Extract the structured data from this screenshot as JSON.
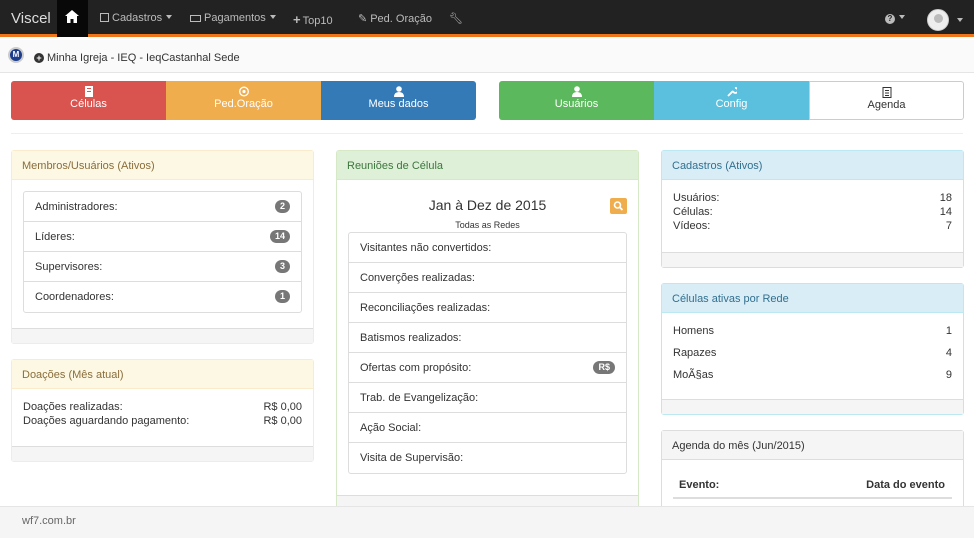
{
  "navbar": {
    "brand": "Viscel",
    "items": [
      "Cadastros",
      "Pagamentos",
      "Top10",
      "Ped. Oração"
    ]
  },
  "subbar": {
    "logo_text": "M",
    "church": "Minha Igreja - IEQ - IeqCastanhal Sede"
  },
  "tiles": [
    {
      "label": "Células",
      "color": "#d9534f"
    },
    {
      "label": "Ped.Oração",
      "color": "#f0ad4e"
    },
    {
      "label": "Meus dados",
      "color": "#337ab7"
    },
    {
      "label": "Usuários",
      "color": "#5cb85c"
    },
    {
      "label": "Config",
      "color": "#5bc0de"
    },
    {
      "label": "Agenda",
      "color": "#ffffff"
    }
  ],
  "membros": {
    "title": "Membros/Usuários (Ativos)",
    "items": [
      {
        "label": "Administradores:",
        "count": "2"
      },
      {
        "label": "Líderes:",
        "count": "14"
      },
      {
        "label": "Supervisores:",
        "count": "3"
      },
      {
        "label": "Coordenadores:",
        "count": "1"
      }
    ]
  },
  "doacoes": {
    "title": "Doações (Mês atual)",
    "rows": [
      {
        "label": "Doações realizadas:",
        "value": "R$ 0,00"
      },
      {
        "label": "Doações aguardando pagamento:",
        "value": "R$ 0,00"
      }
    ]
  },
  "reunioes": {
    "title": "Reuniões de Célula",
    "period": "Jan à Dez de 2015",
    "network": "Todas as Redes",
    "items": [
      {
        "label": "Visitantes não convertidos:",
        "badge": ""
      },
      {
        "label": "Converções realizadas:",
        "badge": ""
      },
      {
        "label": "Reconciliações realizadas:",
        "badge": ""
      },
      {
        "label": "Batismos realizados:",
        "badge": ""
      },
      {
        "label": "Ofertas com propósito:",
        "badge": "R$"
      },
      {
        "label": "Trab. de Evangelização:",
        "badge": ""
      },
      {
        "label": "Ação Social:",
        "badge": ""
      },
      {
        "label": "Visita de Supervisão:",
        "badge": ""
      }
    ]
  },
  "cadastros": {
    "title": "Cadastros (Ativos)",
    "rows": [
      {
        "label": "Usuários:",
        "value": "18"
      },
      {
        "label": "Células:",
        "value": "14"
      },
      {
        "label": "Vídeos:",
        "value": "7"
      }
    ]
  },
  "celulas_rede": {
    "title": "Células ativas por Rede",
    "rows": [
      {
        "label": "Homens",
        "value": "1"
      },
      {
        "label": "Rapazes",
        "value": "4"
      },
      {
        "label": "MoÃ§as",
        "value": "9"
      }
    ]
  },
  "agenda": {
    "title": "Agenda do mês (Jun/2015)",
    "col_event": "Evento:",
    "col_date": "Data do evento"
  },
  "footer": "wf7.com.br"
}
